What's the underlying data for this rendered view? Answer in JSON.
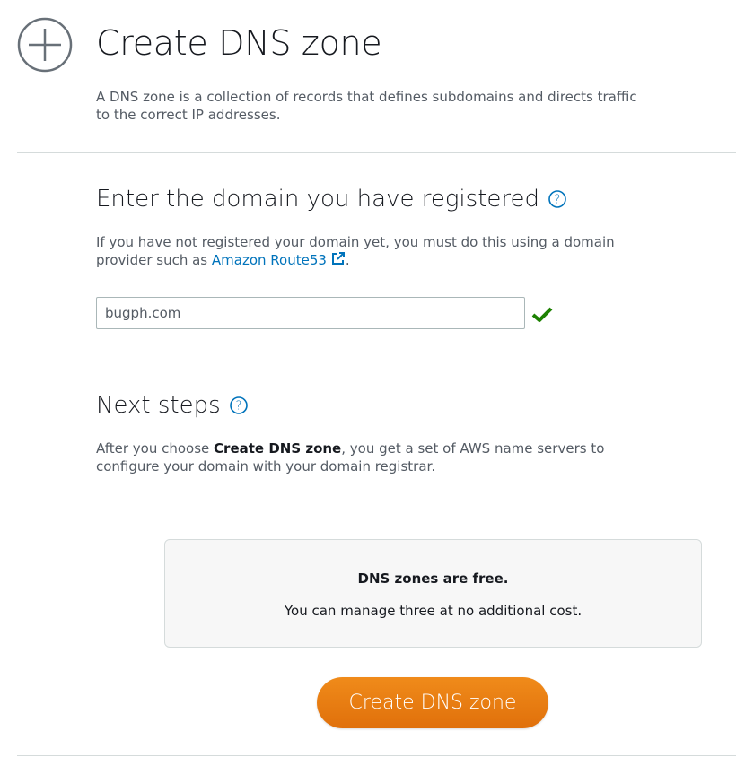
{
  "header": {
    "icon": "add-circle-icon",
    "title": "Create DNS zone",
    "description": "A DNS zone is a collection of records that defines subdomains and directs traffic to the correct IP addresses."
  },
  "domain_section": {
    "heading": "Enter the domain you have registered",
    "help_icon": "help-circle-icon",
    "text_before_link": "If you have not registered your domain yet, you must do this using a domain provider such as ",
    "link_label": "Amazon Route53",
    "link_icon": "external-link-icon",
    "text_after_link": ".",
    "input_value": "bugph.com",
    "valid_icon": "checkmark-icon"
  },
  "next_steps": {
    "heading": "Next steps",
    "help_icon": "help-circle-icon",
    "text_before": "After you choose ",
    "text_bold": "Create DNS zone",
    "text_after": ", you get a set of AWS name servers to configure your domain with your domain registrar."
  },
  "info_box": {
    "title": "DNS zones are free.",
    "text": "You can manage three at no additional cost."
  },
  "primary_button": {
    "label": "Create DNS zone"
  },
  "colors": {
    "accent": "#e0700b",
    "link": "#0073bb",
    "success": "#1d8102"
  }
}
